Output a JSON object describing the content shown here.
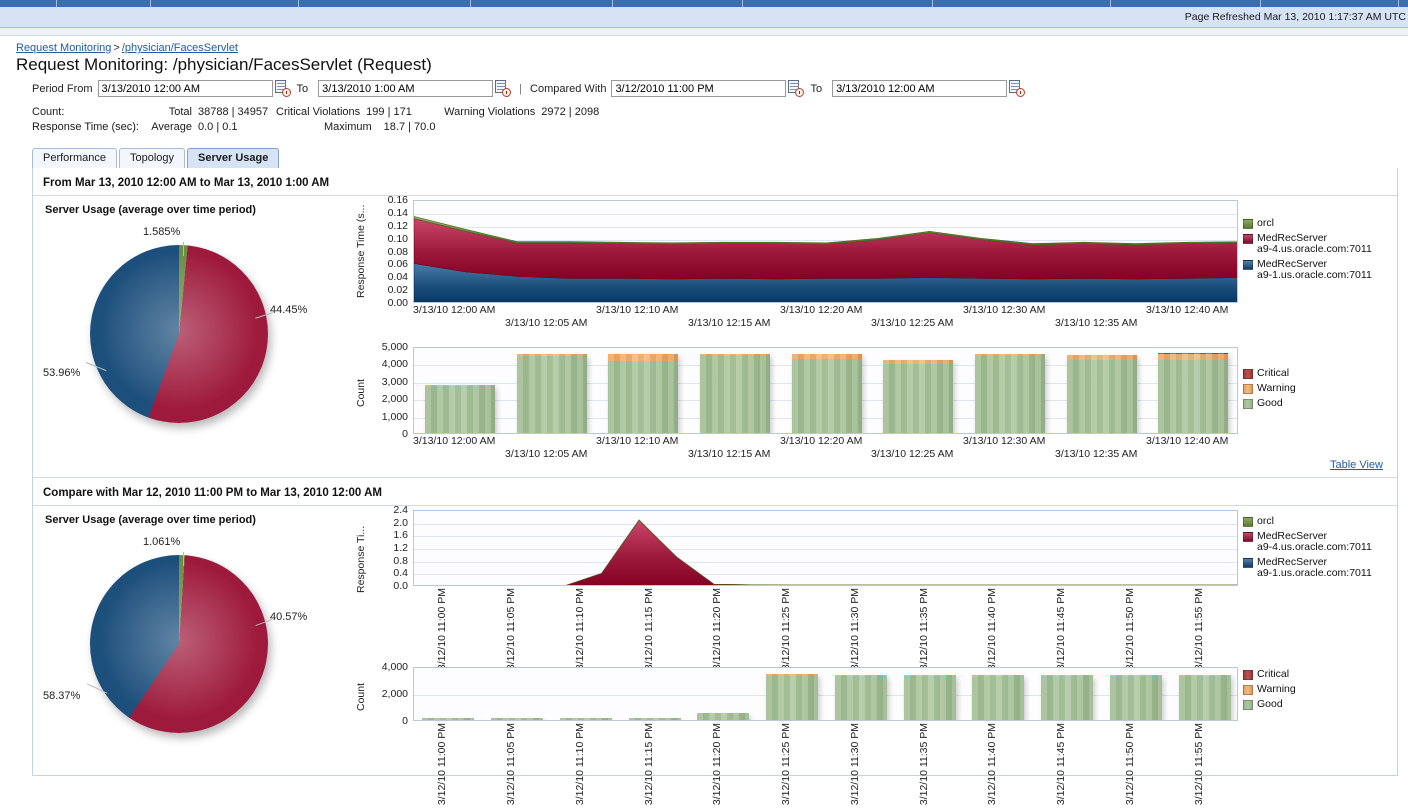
{
  "browser": {
    "refresh_text": "Page Refreshed Mar 13, 2010 1:17:37 AM UTC"
  },
  "breadcrumb": {
    "root": "Request Monitoring",
    "separator": ">",
    "current": "/physician/FacesServlet"
  },
  "page": {
    "title": "Request Monitoring: /physician/FacesServlet (Request)"
  },
  "period": {
    "from_label": "Period From",
    "from_value": "3/13/2010 12:00 AM",
    "to_label_1": "To",
    "to_value_1": "3/13/2010 1:00 AM",
    "divider": "|",
    "compared_label": "Compared With",
    "compared_value": "3/12/2010 11:00 PM",
    "to_label_2": "To",
    "to_value_2": "3/13/2010 12:00 AM"
  },
  "metrics": {
    "count_label": "Count:",
    "response_label": "Response Time (sec):",
    "total_label": "Total",
    "total_value": "38788 | 34957",
    "critical_label": "Critical Violations",
    "critical_value": "199 | 171",
    "warning_label": "Warning Violations",
    "warning_value": "2972 | 2098",
    "average_label": "Average",
    "average_value": "0.0 | 0.1",
    "maximum_label": "Maximum",
    "maximum_value": "18.7 | 70.0"
  },
  "tabs": [
    {
      "label": "Performance",
      "active": false
    },
    {
      "label": "Topology",
      "active": false
    },
    {
      "label": "Server Usage",
      "active": true
    }
  ],
  "section1": {
    "header": "From Mar 13, 2010 12:00 AM to Mar 13, 2010 1:00 AM",
    "pie_title": "Server Usage (average over time period)",
    "table_view": "Table View"
  },
  "section2": {
    "header": "Compare with Mar 12, 2010 11:00 PM to Mar 13, 2010 12:00 AM",
    "pie_title": "Server Usage (average over time period)"
  },
  "legend_servers": [
    {
      "label": "orcl",
      "color": "#6d8c43"
    },
    {
      "label": "MedRecServer\na9-4.us.oracle.com:7011",
      "color": "#8e1838"
    },
    {
      "label": "MedRecServer\na9-1.us.oracle.com:7011",
      "color": "#1d4f7c"
    }
  ],
  "legend_status": [
    {
      "label": "Critical",
      "color": "#a33b3b"
    },
    {
      "label": "Warning",
      "color": "#e8a661"
    },
    {
      "label": "Good",
      "color": "#9cba8e"
    }
  ],
  "chart_data": [
    {
      "id": "pie-1",
      "type": "pie",
      "title": "Server Usage (average over time period)",
      "labels": [
        "orcl",
        "MedRecServer a9-4.us.oracle.com:7011",
        "MedRecServer a9-1.us.oracle.com:7011"
      ],
      "values": [
        1.585,
        53.96,
        44.45
      ],
      "value_labels": [
        "1.585%",
        "53.96%",
        "44.45%"
      ],
      "colors": [
        "#6d8c43",
        "#9e1a3c",
        "#1d4f7c"
      ],
      "legend": "right"
    },
    {
      "id": "area-1",
      "type": "area",
      "stacked": true,
      "ylabel": "Response Time (s...",
      "xlabel": "",
      "ylim": [
        0,
        0.16
      ],
      "yticks": [
        "0.00",
        "0.02",
        "0.04",
        "0.06",
        "0.08",
        "0.10",
        "0.12",
        "0.14",
        "0.16"
      ],
      "xticks": [
        "3/13/10 12:00 AM",
        "3/13/10 12:05 AM",
        "3/13/10 12:10 AM",
        "3/13/10 12:15 AM",
        "3/13/10 12:20 AM",
        "3/13/10 12:25 AM",
        "3/13/10 12:30 AM",
        "3/13/10 12:35 AM",
        "3/13/10 12:40 AM"
      ],
      "grid": true,
      "series": [
        {
          "name": "MedRecServer a9-1.us.oracle.com:7011",
          "color": "#1d4f7c",
          "values": [
            0.063,
            0.05,
            0.043,
            0.04,
            0.04,
            0.039,
            0.04,
            0.039,
            0.04,
            0.04,
            0.041,
            0.04,
            0.039,
            0.04,
            0.039,
            0.04,
            0.041
          ]
        },
        {
          "name": "MedRecServer a9-4.us.oracle.com:7011",
          "color": "#9e1a3c",
          "values": [
            0.07,
            0.063,
            0.052,
            0.055,
            0.054,
            0.054,
            0.054,
            0.055,
            0.053,
            0.06,
            0.07,
            0.06,
            0.053,
            0.054,
            0.053,
            0.054,
            0.054
          ]
        },
        {
          "name": "orcl",
          "color": "#6d8c43",
          "values": [
            0.003,
            0.003,
            0.002,
            0.002,
            0.002,
            0.002,
            0.002,
            0.002,
            0.002,
            0.002,
            0.002,
            0.002,
            0.002,
            0.002,
            0.002,
            0.002,
            0.002
          ]
        }
      ]
    },
    {
      "id": "bar-1",
      "type": "bar",
      "stacked": true,
      "ylabel": "Count",
      "ylim": [
        0,
        5000
      ],
      "yticks": [
        "0",
        "1,000",
        "2,000",
        "3,000",
        "4,000",
        "5,000"
      ],
      "categories": [
        "3/13/10 12:00 AM",
        "3/13/10 12:05 AM",
        "3/13/10 12:10 AM",
        "3/13/10 12:15 AM",
        "3/13/10 12:20 AM",
        "3/13/10 12:25 AM",
        "3/13/10 12:30 AM",
        "3/13/10 12:35 AM",
        "3/13/10 12:40 AM"
      ],
      "series": [
        {
          "name": "Good",
          "color": "#9cba8e",
          "values": [
            2700,
            4400,
            4150,
            4480,
            4250,
            3950,
            4480,
            4200,
            4150
          ]
        },
        {
          "name": "Warning",
          "color": "#e8a661",
          "values": [
            80,
            120,
            400,
            40,
            280,
            230,
            40,
            280,
            380
          ]
        },
        {
          "name": "Critical",
          "color": "#a33b3b",
          "values": [
            0,
            0,
            0,
            0,
            0,
            0,
            0,
            0,
            40
          ]
        }
      ]
    },
    {
      "id": "pie-2",
      "type": "pie",
      "title": "Server Usage (average over time period)",
      "labels": [
        "orcl",
        "MedRecServer a9-4.us.oracle.com:7011",
        "MedRecServer a9-1.us.oracle.com:7011"
      ],
      "values": [
        1.061,
        58.37,
        40.57
      ],
      "value_labels": [
        "1.061%",
        "58.37%",
        "40.57%"
      ],
      "colors": [
        "#6d8c43",
        "#9e1a3c",
        "#1d4f7c"
      ],
      "legend": "right"
    },
    {
      "id": "area-2",
      "type": "area",
      "stacked": true,
      "ylabel": "Response Ti...",
      "ylim": [
        0,
        2.4
      ],
      "yticks": [
        "0.0",
        "0.4",
        "0.8",
        "1.2",
        "1.6",
        "2.0",
        "2.4"
      ],
      "xticks": [
        "3/12/10\n11:00 PM",
        "3/12/10\n11:05 PM",
        "3/12/10\n11:10 PM",
        "3/12/10\n11:15 PM",
        "3/12/10\n11:20 PM",
        "3/12/10\n11:25 PM",
        "3/12/10\n11:30 PM",
        "3/12/10\n11:35 PM",
        "3/12/10\n11:40 PM",
        "3/12/10\n11:45 PM",
        "3/12/10\n11:50 PM",
        "3/12/10\n11:55 PM"
      ],
      "grid": true,
      "series": [
        {
          "name": "MedRecServer a9-1.us.oracle.com:7011",
          "color": "#1d4f7c",
          "values": [
            0.02,
            0.02,
            0.02,
            0.02,
            0.02,
            0.03,
            0.06,
            0.05,
            0.04,
            0.03,
            0.03,
            0.03,
            0.03,
            0.03,
            0.03,
            0.03,
            0.03,
            0.03,
            0.03,
            0.03,
            0.03,
            0.03,
            0.03
          ]
        },
        {
          "name": "MedRecServer a9-4.us.oracle.com:7011",
          "color": "#9e1a3c",
          "values": [
            0.01,
            0.01,
            0.01,
            0.01,
            0.01,
            0.4,
            2.05,
            0.9,
            0.05,
            0.04,
            0.03,
            0.03,
            0.03,
            0.03,
            0.03,
            0.03,
            0.03,
            0.03,
            0.03,
            0.03,
            0.03,
            0.03,
            0.03
          ]
        },
        {
          "name": "orcl",
          "color": "#6d8c43",
          "values": [
            0.0,
            0.0,
            0.0,
            0.0,
            0.0,
            0.0,
            0.01,
            0.0,
            0.0,
            0.0,
            0.0,
            0.0,
            0.0,
            0.0,
            0.0,
            0.0,
            0.0,
            0.0,
            0.0,
            0.0,
            0.0,
            0.0,
            0.0
          ]
        }
      ]
    },
    {
      "id": "bar-2",
      "type": "bar",
      "stacked": true,
      "ylabel": "Count",
      "ylim": [
        0,
        5000
      ],
      "yticks": [
        "0",
        "2,000",
        "4,000"
      ],
      "categories": [
        "3/12/10\n11:00 PM",
        "3/12/10\n11:05 PM",
        "3/12/10\n11:10 PM",
        "3/12/10\n11:15 PM",
        "3/12/10\n11:20 PM",
        "3/12/10\n11:25 PM",
        "3/12/10\n11:30 PM",
        "3/12/10\n11:35 PM",
        "3/12/10\n11:40 PM",
        "3/12/10\n11:45 PM",
        "3/12/10\n11:50 PM",
        "3/12/10\n11:55 PM"
      ],
      "series": [
        {
          "name": "Good",
          "color": "#9cba8e",
          "values": [
            180,
            160,
            170,
            170,
            620,
            4150,
            4100,
            4100,
            4100,
            4150,
            4100,
            4100
          ]
        },
        {
          "name": "Warning",
          "color": "#e8a661",
          "values": [
            0,
            0,
            0,
            0,
            0,
            60,
            60,
            60,
            60,
            60,
            60,
            60
          ]
        },
        {
          "name": "Critical",
          "color": "#a33b3b",
          "values": [
            0,
            0,
            0,
            0,
            0,
            40,
            0,
            0,
            0,
            0,
            0,
            0
          ]
        }
      ]
    }
  ]
}
